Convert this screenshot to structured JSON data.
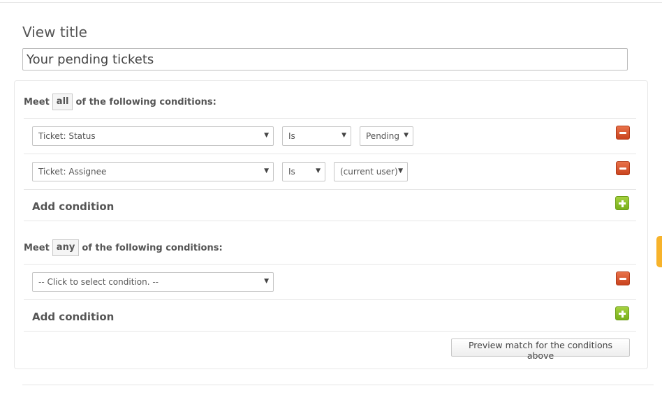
{
  "view_title": {
    "label": "View title",
    "value": "Your pending tickets"
  },
  "all_section": {
    "prefix": "Meet",
    "mode": "all",
    "suffix": "of the following conditions:",
    "conditions": [
      {
        "field": "Ticket: Status",
        "operator": "Is",
        "value": "Pending"
      },
      {
        "field": "Ticket: Assignee",
        "operator": "Is",
        "value": "(current user)"
      }
    ],
    "add_label": "Add condition"
  },
  "any_section": {
    "prefix": "Meet",
    "mode": "any",
    "suffix": "of the following conditions:",
    "conditions": [
      {
        "field": "-- Click to select condition. --"
      }
    ],
    "add_label": "Add condition"
  },
  "preview_label": "Preview match for the conditions above",
  "icons": {
    "remove": "minus-icon",
    "add": "plus-icon",
    "dropdown": "caret-down-icon"
  },
  "colors": {
    "remove": "#d9542b",
    "add": "#8cc030",
    "side_tab": "#f7b32b"
  }
}
